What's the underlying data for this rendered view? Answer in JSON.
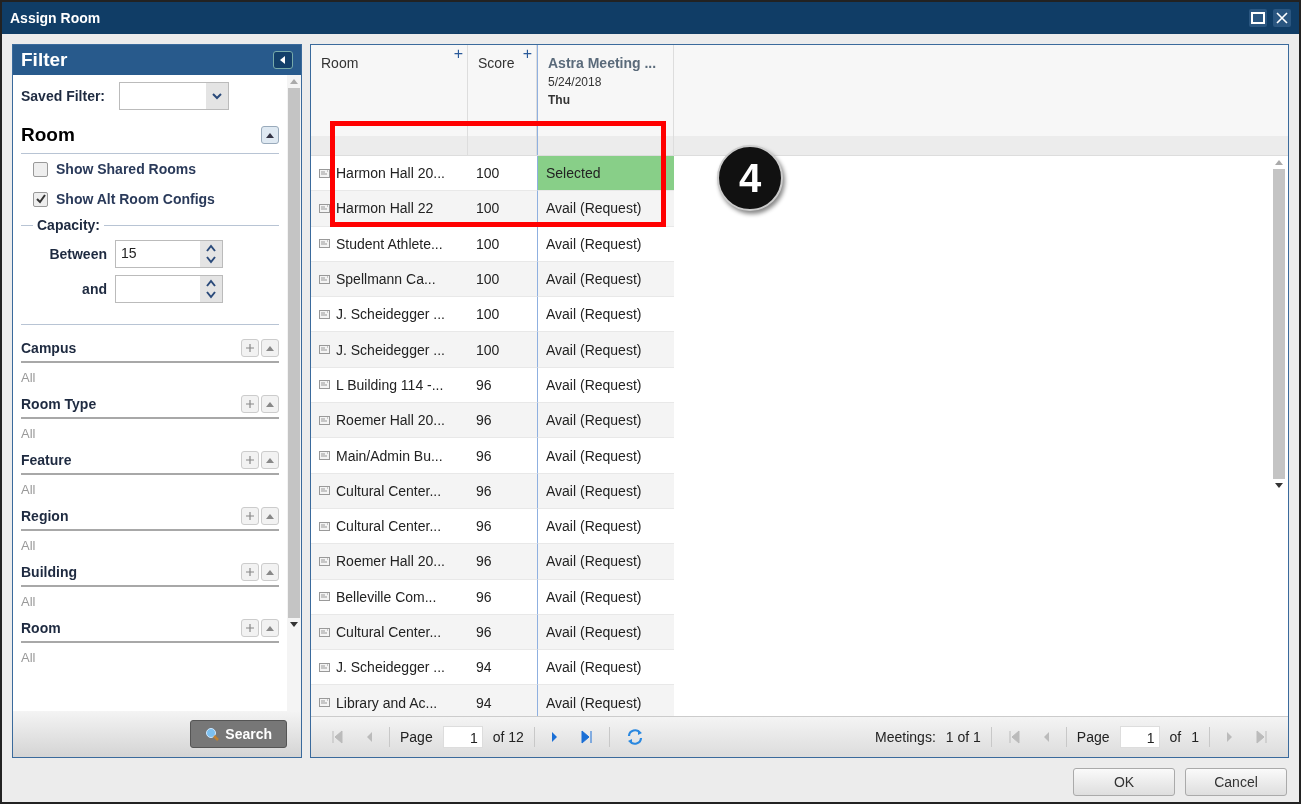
{
  "window": {
    "title": "Assign Room"
  },
  "filter": {
    "title": "Filter",
    "saved_filter_label": "Saved Filter:",
    "room_title": "Room",
    "checkboxes": [
      {
        "label": "Show Shared Rooms",
        "checked": false
      },
      {
        "label": "Show Alt Room Configs",
        "checked": true
      }
    ],
    "capacity_label": "Capacity:",
    "between_label": "Between",
    "between_value": "15",
    "and_label": "and",
    "sections": [
      {
        "title": "Campus",
        "value": "All"
      },
      {
        "title": "Room Type",
        "value": "All"
      },
      {
        "title": "Feature",
        "value": "All"
      },
      {
        "title": "Region",
        "value": "All"
      },
      {
        "title": "Building",
        "value": "All"
      },
      {
        "title": "Room",
        "value": "All"
      }
    ],
    "search_button": "Search"
  },
  "table": {
    "columns": [
      {
        "label": "Room",
        "add_mark": "+"
      },
      {
        "label": "Score",
        "add_mark": "+"
      }
    ],
    "meeting": {
      "title": "Astra Meeting ...",
      "date": "5/24/2018",
      "day": "Thu"
    },
    "rows": [
      {
        "room": "Harmon Hall 20...",
        "score": "100",
        "status": "Selected",
        "selected": true
      },
      {
        "room": "Harmon Hall 22",
        "score": "100",
        "status": "Avail (Request)",
        "selected": false
      },
      {
        "room": "Student Athlete...",
        "score": "100",
        "status": "Avail (Request)",
        "selected": false
      },
      {
        "room": "Spellmann Ca...",
        "score": "100",
        "status": "Avail (Request)",
        "selected": false
      },
      {
        "room": "J. Scheidegger ...",
        "score": "100",
        "status": "Avail (Request)",
        "selected": false
      },
      {
        "room": "J. Scheidegger ...",
        "score": "100",
        "status": "Avail (Request)",
        "selected": false
      },
      {
        "room": "L Building 114 -...",
        "score": "96",
        "status": "Avail (Request)",
        "selected": false
      },
      {
        "room": "Roemer Hall 20...",
        "score": "96",
        "status": "Avail (Request)",
        "selected": false
      },
      {
        "room": "Main/Admin Bu...",
        "score": "96",
        "status": "Avail (Request)",
        "selected": false
      },
      {
        "room": "Cultural Center...",
        "score": "96",
        "status": "Avail (Request)",
        "selected": false
      },
      {
        "room": "Cultural Center...",
        "score": "96",
        "status": "Avail (Request)",
        "selected": false
      },
      {
        "room": "Roemer Hall 20...",
        "score": "96",
        "status": "Avail (Request)",
        "selected": false
      },
      {
        "room": "Belleville Com...",
        "score": "96",
        "status": "Avail (Request)",
        "selected": false
      },
      {
        "room": "Cultural Center...",
        "score": "96",
        "status": "Avail (Request)",
        "selected": false
      },
      {
        "room": "J. Scheidegger ...",
        "score": "94",
        "status": "Avail (Request)",
        "selected": false
      },
      {
        "room": "Library and Ac...",
        "score": "94",
        "status": "Avail (Request)",
        "selected": false
      }
    ]
  },
  "pager": {
    "page_label": "Page",
    "page": "1",
    "of": "of 12",
    "meetings_label": "Meetings:",
    "meetings": "1 of 1",
    "page_label_2": "Page",
    "page_2": "1",
    "of_2_label": "of",
    "of_2": "1"
  },
  "callout": "4",
  "buttons": [
    "OK",
    "Cancel"
  ]
}
